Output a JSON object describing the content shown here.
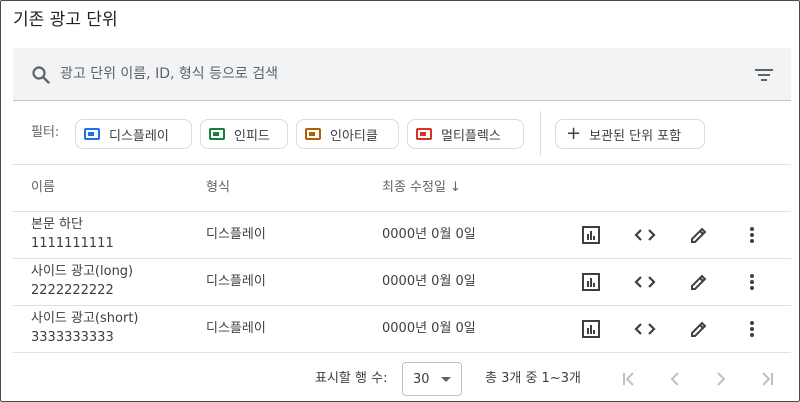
{
  "page": {
    "title": "기존 광고 단위"
  },
  "search": {
    "placeholder": "광고 단위 이름, ID, 형식 등으로 검색"
  },
  "filters": {
    "label": "필터:",
    "chips": [
      {
        "label": "디스플레이",
        "color": "#1a73e8"
      },
      {
        "label": "인피드",
        "color": "#188038"
      },
      {
        "label": "인아티클",
        "color": "#b06000"
      },
      {
        "label": "멀티플렉스",
        "color": "#d93025"
      }
    ],
    "archived_label": "보관된 단위 포함"
  },
  "table": {
    "headers": {
      "name": "이름",
      "format": "형식",
      "modified": "최종 수정일"
    },
    "sort_icon": "arrow-down-icon",
    "rows": [
      {
        "name": "본문 하단",
        "id": "1111111111",
        "format": "디스플레이",
        "modified": "0000년 0월 0일"
      },
      {
        "name": "사이드 광고(long)",
        "id": "2222222222",
        "format": "디스플레이",
        "modified": "0000년 0월 0일"
      },
      {
        "name": "사이드 광고(short)",
        "id": "3333333333",
        "format": "디스플레이",
        "modified": "0000년 0월 0일"
      }
    ],
    "row_actions": [
      "bar-chart-icon",
      "code-icon",
      "edit-pencil-icon",
      "more-vert-icon"
    ]
  },
  "pagination": {
    "rows_per_page_label": "표시할 행 수:",
    "rows_per_page": "30",
    "range_text": "총 3개 중 1~3개",
    "buttons": [
      "first-page-icon",
      "prev-page-icon",
      "next-page-icon",
      "last-page-icon"
    ]
  }
}
